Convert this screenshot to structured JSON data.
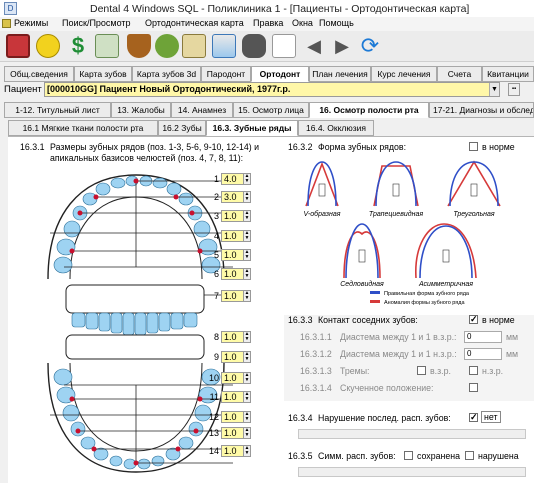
{
  "window": {
    "title": "Dental 4 Windows SQL - Поликлиника 1 - [Пациенты - Ортодонтическая карта]"
  },
  "menu": [
    "Режимы",
    "Поиск/Просмотр",
    "Ортодонтическая карта",
    "Правка",
    "Окна",
    "Помощь"
  ],
  "toolbar_icons": [
    "settings-icon",
    "smiley-icon",
    "dollar-icon",
    "envelope-icon",
    "shield-icon",
    "gears-icon",
    "card-icon",
    "chart-icon",
    "binoculars-icon",
    "back-arrow-icon",
    "forward-arrow-icon",
    "refresh-icon"
  ],
  "main_tabs": [
    "Общ.сведения",
    "Карта зубов",
    "Карта зубов 3d",
    "Пародонт",
    "Ортодонт",
    "План лечения",
    "Курс лечения",
    "Счета",
    "Квитанции"
  ],
  "patient": {
    "label": "Пациент",
    "value": "[000010GG] Пациент Новый Ортодонтический, 1977г.р."
  },
  "section_tabs": [
    "1-12. Титульный лист",
    "13. Жалобы",
    "14. Анамнез",
    "15. Осмотр лица",
    "16. Осмотр полости рта",
    "17-21. Диагнозы и обследо"
  ],
  "sub_tabs": [
    "16.1 Мягкие ткани полости рта",
    "16.2 Зубы",
    "16.3. Зубные ряды",
    "16.4. Окклюзия"
  ],
  "sizes_section": {
    "num": "16.3.1",
    "title": "Размеры зубных рядов (поз. 1-3, 5-6, 9-10, 12-14) и",
    "title2": "апикальных базисов челюстей (поз. 4, 7, 8, 11):",
    "rows": [
      {
        "n": "1",
        "v": "4.0"
      },
      {
        "n": "2",
        "v": "3.0"
      },
      {
        "n": "3",
        "v": "1.0"
      },
      {
        "n": "4",
        "v": "1.0"
      },
      {
        "n": "5",
        "v": "1.0"
      },
      {
        "n": "6",
        "v": "1.0"
      },
      {
        "n": "7",
        "v": "1.0"
      },
      {
        "n": "8",
        "v": "1.0"
      },
      {
        "n": "9",
        "v": "1.0"
      },
      {
        "n": "10",
        "v": "1.0"
      },
      {
        "n": "11",
        "v": "1.0"
      },
      {
        "n": "12",
        "v": "1.0"
      },
      {
        "n": "13",
        "v": "1.0"
      },
      {
        "n": "14",
        "v": "1.0"
      }
    ]
  },
  "shape_section": {
    "num": "16.3.2",
    "title": "Форма зубных рядов:",
    "normal": "в норме",
    "shapes": [
      "V-образная",
      "Трапециевидная",
      "Треугольная",
      "Седловидная",
      "Асимметричная"
    ],
    "legend": [
      "Правильная форма зубного ряда",
      "Аномалия формы зубного ряда"
    ],
    "colors": {
      "normal": "#2f4fc8",
      "anomaly": "#d63a3a"
    }
  },
  "contact_section": {
    "num": "16.3.3",
    "title": "Контакт соседних зубов:",
    "normal": "в норме",
    "items": [
      {
        "num": "16.3.1.1",
        "label": "Диастема между 1 и 1 в.з.р.:",
        "value": "0",
        "unit": "мм"
      },
      {
        "num": "16.3.1.2",
        "label": "Диастема между 1 и 1 н.з.р.:",
        "value": "0",
        "unit": "мм"
      },
      {
        "num": "16.3.1.3",
        "label": "Тремы:",
        "opt1": "в.з.р.",
        "opt2": "н.з.р."
      },
      {
        "num": "16.3.1.4",
        "label": "Скученное положение:"
      }
    ]
  },
  "disorder_section": {
    "num": "16.3.4",
    "title": "Нарушение послед. расп. зубов:",
    "value": "нет"
  },
  "symmetry_section": {
    "num": "16.3.5",
    "title": "Симм. расп. зубов:",
    "opt1": "сохранена",
    "opt2": "нарушена"
  }
}
